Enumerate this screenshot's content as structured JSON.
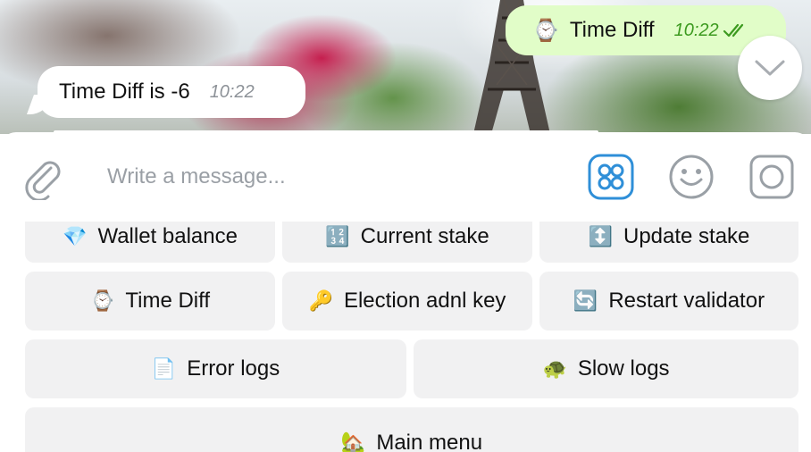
{
  "messages": {
    "outgoing": {
      "emoji": "⌚",
      "text": "Time Diff",
      "time": "10:22",
      "check_icon": "double-check-icon"
    },
    "incoming": {
      "text": "Time Diff is -6",
      "time": "10:22"
    }
  },
  "composer": {
    "placeholder": "Write a message...",
    "attach_icon": "paperclip-icon",
    "keyboard_icon": "bot-keyboard-icon",
    "emoji_icon": "smiley-icon",
    "camera_icon": "camera-icon"
  },
  "keyboard": {
    "rows": [
      [
        {
          "emoji": "💎",
          "label": "Wallet balance"
        },
        {
          "emoji": "🔢",
          "label": "Current stake"
        },
        {
          "emoji": "↕️",
          "label": "Update stake"
        }
      ],
      [
        {
          "emoji": "⌚",
          "label": "Time Diff"
        },
        {
          "emoji": "🔑",
          "label": "Election adnl key"
        },
        {
          "emoji": "🔄",
          "label": "Restart validator"
        }
      ],
      [
        {
          "emoji": "📄",
          "label": "Error logs"
        },
        {
          "emoji": "🐢",
          "label": "Slow logs"
        }
      ],
      [
        {
          "emoji": "🏡",
          "label": "Main menu"
        }
      ]
    ]
  },
  "colors": {
    "accent": "#2f8fd8",
    "outgoing_bubble": "#e1fdc8",
    "outgoing_time": "#3c9a1f",
    "key_background": "#f1f1f2"
  }
}
